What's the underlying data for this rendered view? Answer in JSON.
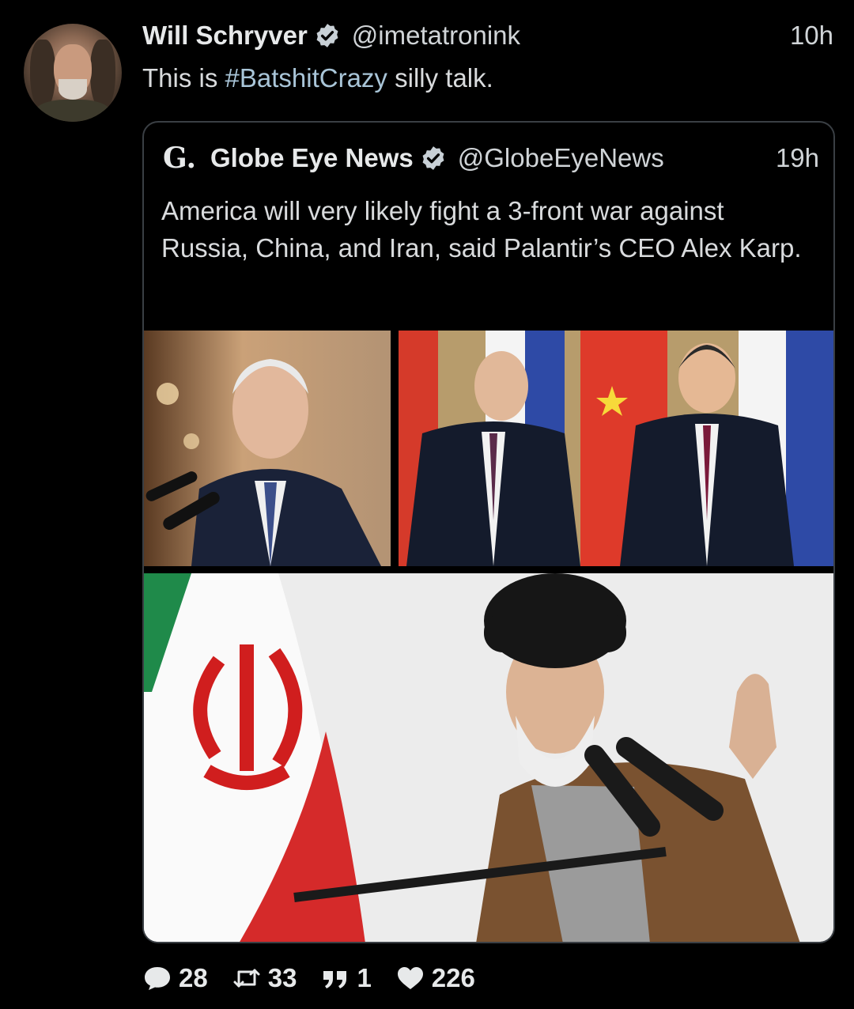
{
  "author": {
    "name": "Will Schryver",
    "handle": "@imetatronink",
    "time": "10h",
    "verified": true
  },
  "tweet": {
    "text_before": "This is ",
    "hashtag": "#BatshitCrazy",
    "text_after": " silly talk."
  },
  "quoted": {
    "logo": "G.",
    "name": "Globe Eye News",
    "handle": "@GlobeEyeNews",
    "time": "19h",
    "verified": true,
    "text": "America will very likely fight a 3-front war against Russia, China, and Iran, said Palantir’s CEO Alex Karp."
  },
  "actions": {
    "replies": "28",
    "retweets": "33",
    "quotes": "1",
    "likes": "226"
  },
  "colors": {
    "background": "#000000",
    "hashtag": "#a9c5d8",
    "verified_badge": "#c8d0d6",
    "border": "#3a3f44"
  },
  "icons": [
    "verified-badge-icon",
    "reply-icon",
    "retweet-icon",
    "quote-icon",
    "like-icon"
  ]
}
